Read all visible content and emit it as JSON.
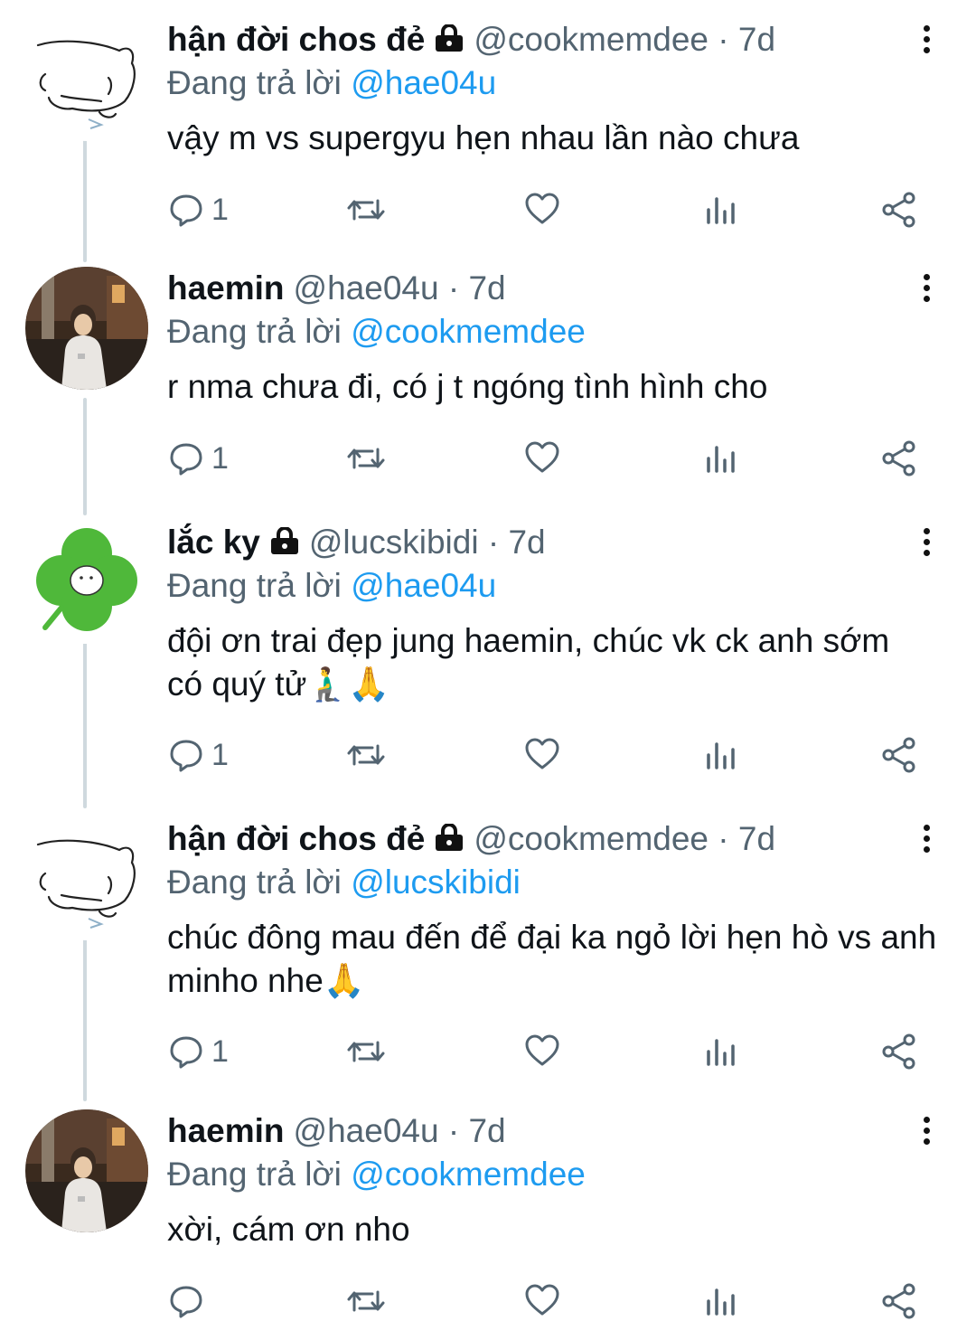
{
  "tweets": [
    {
      "name": "hận đời chos đẻ",
      "locked": true,
      "handle": "@cookmemdee",
      "time": "7d",
      "reply_prefix": "Đang trả lời",
      "reply_to": "@hae04u",
      "text": "vậy m vs supergyu hẹn nhau lần nào chưa",
      "reply_count": "1",
      "avatar": "sketch-avatar"
    },
    {
      "name": "haemin",
      "locked": false,
      "handle": "@hae04u",
      "time": "7d",
      "reply_prefix": "Đang trả lời",
      "reply_to": "@cookmemdee",
      "text": "r nma chưa đi, có j t ngóng tình hình cho",
      "reply_count": "1",
      "avatar": "photo-avatar"
    },
    {
      "name": "lắc ky",
      "locked": true,
      "handle": "@lucskibidi",
      "time": "7d",
      "reply_prefix": "Đang trả lời",
      "reply_to": "@hae04u",
      "text": "đội ơn trai đẹp jung haemin, chúc vk ck anh sớm có quý tử🧎‍♂️🙏",
      "reply_count": "1",
      "avatar": "clover-avatar"
    },
    {
      "name": "hận đời chos đẻ",
      "locked": true,
      "handle": "@cookmemdee",
      "time": "7d",
      "reply_prefix": "Đang trả lời",
      "reply_to": "@lucskibidi",
      "text": "chúc đông mau đến để đại ka ngỏ lời hẹn hò vs anh minho nhe🙏",
      "reply_count": "1",
      "avatar": "sketch-avatar"
    },
    {
      "name": "haemin",
      "locked": false,
      "handle": "@hae04u",
      "time": "7d",
      "reply_prefix": "Đang trả lời",
      "reply_to": "@cookmemdee",
      "text": "xời, cám ơn nho",
      "reply_count": "",
      "avatar": "photo-avatar"
    }
  ],
  "separator": "·",
  "icons": {
    "reply": "reply-icon",
    "retweet": "retweet-icon",
    "like": "heart-icon",
    "views": "views-icon",
    "share": "share-icon",
    "more": "more-vertical-icon",
    "lock": "lock-icon"
  },
  "colors": {
    "mention": "#1d9bf0",
    "secondary_text": "#536471",
    "thread_line": "#cfd9de",
    "clover": "#4fb83a"
  }
}
